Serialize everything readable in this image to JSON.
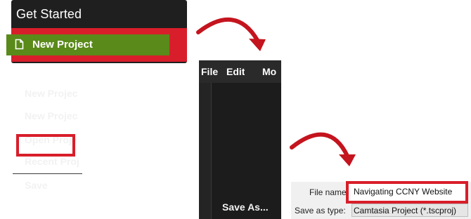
{
  "get_started": {
    "title": "Get Started",
    "new_project_label": "New Project"
  },
  "file_menu": {
    "menubar": [
      "File",
      "Edit",
      "Mo"
    ],
    "items": [
      "New Projec",
      "New Projec",
      "Open Proje",
      "Recent Proj",
      "Save",
      "Save As..."
    ]
  },
  "save_dialog": {
    "file_name_label": "File name:",
    "file_name_value": "Navigating CCNY Website",
    "save_as_type_label": "Save as type:",
    "save_as_type_value": "Camtasia Project (*.tscproj)"
  },
  "colors": {
    "highlight_red": "#d81e2a",
    "button_green": "#5a8a1a",
    "dark_bg": "#1f1f1f"
  },
  "icons": {
    "new_project": "document-icon",
    "arrows": "curved-arrow-icon"
  }
}
